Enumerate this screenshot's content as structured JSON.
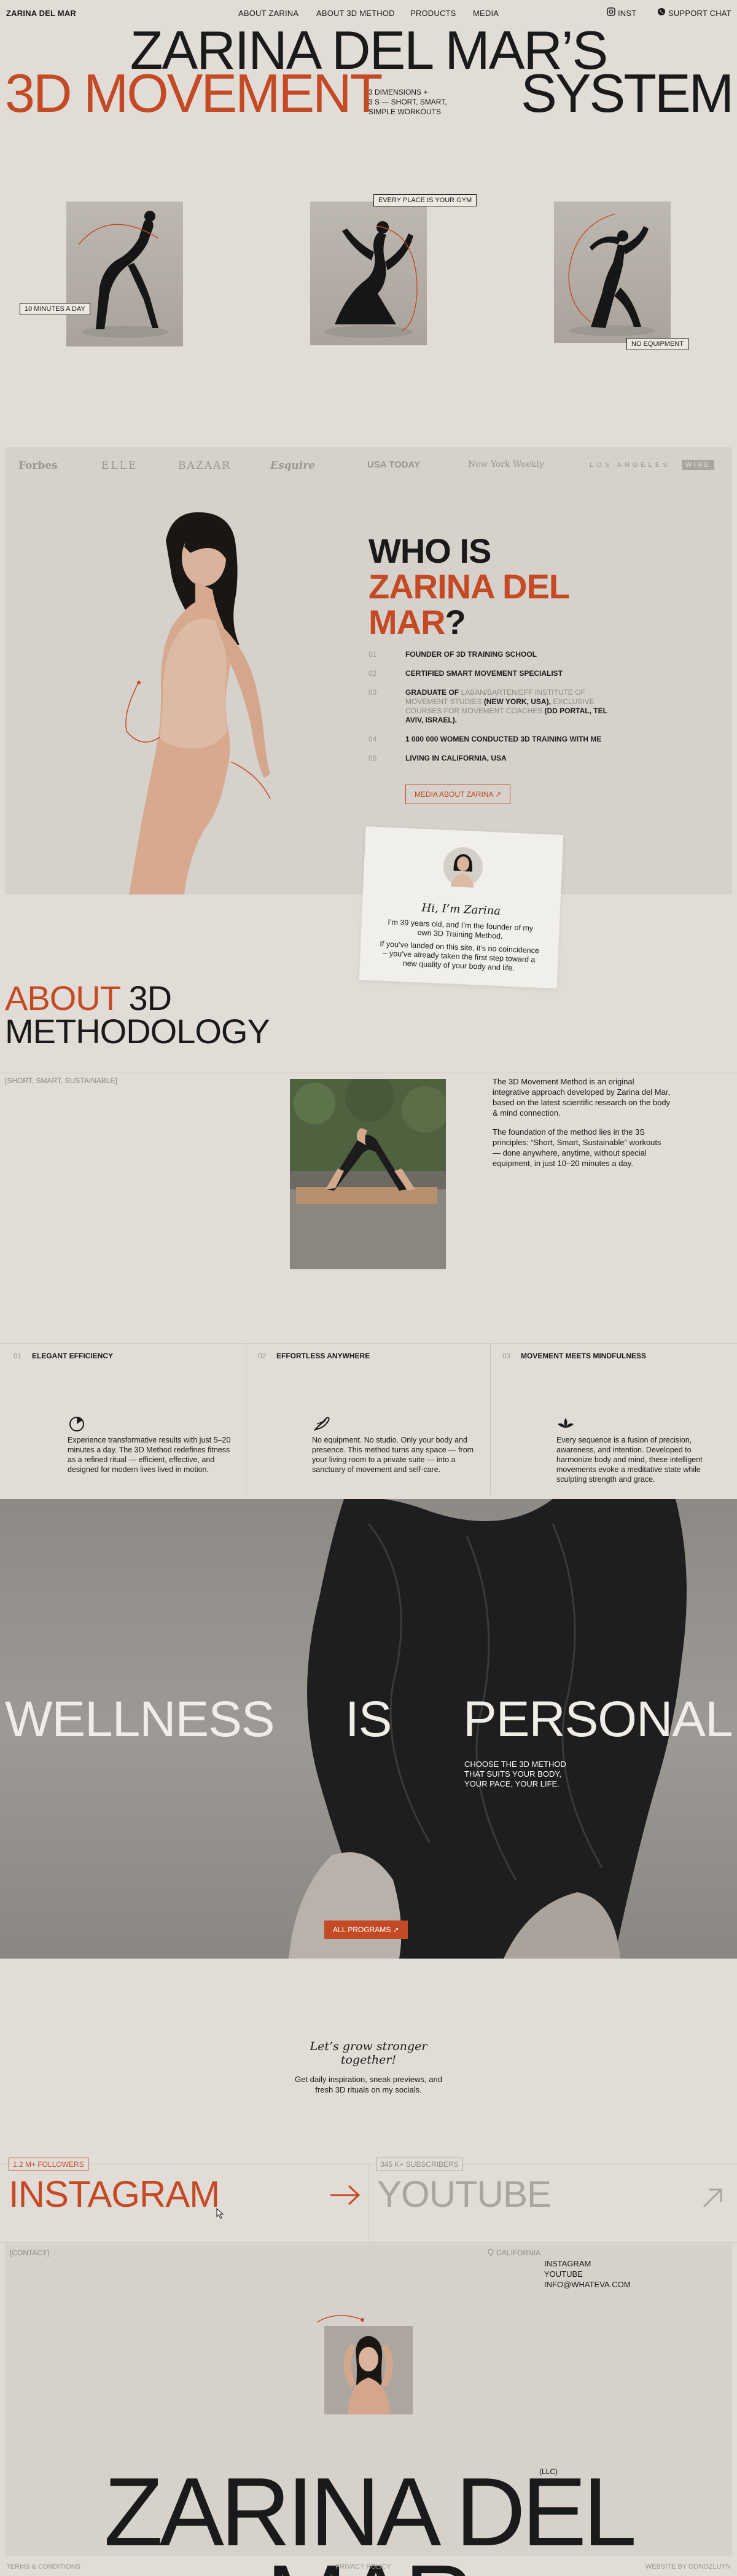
{
  "nav": {
    "brand": "ZARINA DEL MAR",
    "links": [
      "ABOUT ZARINA",
      "ABOUT 3D METHOD",
      "PRODUCTS",
      "MEDIA"
    ],
    "inst": "INST",
    "support": "SUPPORT CHAT"
  },
  "hero": {
    "line1": "ZARINA DEL MAR’S",
    "line2_left": "3D MOVEMENT",
    "line2_right": "SYSTEM",
    "tagline": [
      "3 DIMENSIONS  +",
      "3 S — SHORT, SMART,",
      "SIMPLE WORKOUTS"
    ],
    "tags": {
      "minutes": "10 MINUTES A DAY",
      "gym": "EVERY PLACE IS YOUR GYM",
      "equipment": "NO EQUIPMENT"
    }
  },
  "logos": [
    "Forbes",
    "ELLE",
    "BAZAAR",
    "Esquire",
    "USA TODAY",
    "New York Weekly",
    "LOS ANGELES",
    "WIRE"
  ],
  "who": {
    "title_1": "WHO IS",
    "title_2": "ZARINA DEL",
    "title_3a": "MAR",
    "title_3b": "?",
    "items": [
      {
        "num": "01",
        "text": "FOUNDER OF 3D TRAINING SCHOOL"
      },
      {
        "num": "02",
        "text": "CERTIFIED SMART MOVEMENT SPECIALIST"
      },
      {
        "num": "03",
        "strong": "GRADUATE OF",
        "text": "LABAN/BARTENIEFF INSTITUTE OF MOVEMENT STUDIES",
        "strong2": "(NEW YORK, USA),",
        "text2": "EXCLUSIVE COURSES FOR MOVEMENT COACHES",
        "strong3": "(DD PORTAL, TEL AVIV, ISRAEL)."
      },
      {
        "num": "04",
        "text": "1 000 000 WOMEN CONDUCTED 3D TRAINING WITH ME"
      },
      {
        "num": "05",
        "text": "LIVING IN CALIFORNIA, USA"
      }
    ],
    "media_button": "MEDIA ABOUT ZARINA ↗",
    "note": {
      "greeting": "Hi, I’m Zarina",
      "p1": "I’m 39 years old, and I’m the founder of my own 3D Training Method.",
      "p2": "If you’ve landed on this site, it’s no coincidence – you’ve already taken the first step toward a new quality of your body and life."
    }
  },
  "about": {
    "title_1a": "ABOUT",
    "title_1b": "3D",
    "title_2": "METHODOLOGY",
    "tag": "[SHORT, SMART, SUSTAINABLE]",
    "p1": "The 3D Movement Method is an original integrative approach developed by Zarina del Mar, based on the latest scientific research on the body & mind connection.",
    "p2": "The foundation of the method lies in the 3S principles: “Short, Smart, Sustainable” workouts — done anywhere, anytime, without special equipment, in just 10–20 minutes a day.",
    "features": [
      {
        "num": "01",
        "title": "ELEGANT EFFICIENCY",
        "icon": "timer-icon",
        "text": "Experience transformative results with just 5–20 minutes a day. The 3D Method redefines fitness as a refined ritual — efficient, effective, and designed for modern lives lived in motion."
      },
      {
        "num": "02",
        "title": "EFFORTLESS ANYWHERE",
        "icon": "feather-icon",
        "text": "No equipment. No studio. Only your body and presence. This method turns any space — from your living room to a private suite — into a sanctuary of movement and self-care."
      },
      {
        "num": "03",
        "title": "MOVEMENT MEETS MINDFULNESS",
        "icon": "lotus-icon",
        "text": "Every sequence is a fusion of precision, awareness, and intention. Developed to harmonize body and mind, these intelligent movements evoke a meditative state while sculpting strength and grace."
      }
    ]
  },
  "wellness": {
    "w1": "WELLNESS",
    "w2": "IS",
    "w3": "PERSONAL",
    "sub": [
      "CHOOSE THE 3D METHOD",
      "THAT SUITS YOUR BODY,",
      "YOUR PACE, YOUR LIFE."
    ],
    "button": "ALL PROGRAMS ↗"
  },
  "social": {
    "script": "Let’s grow stronger together!",
    "text": "Get daily inspiration, sneak previews, and fresh 3D rituals on my socials.",
    "instagram_badge": "1.2 M+ FOLLOWERS",
    "instagram": "INSTAGRAM",
    "youtube_badge": "345 K+ SUBSCRIBERS",
    "youtube": "YOUTUBE"
  },
  "contact": {
    "tag": "[CONTACT]",
    "location": "CALIFORNIA",
    "links": [
      "INSTAGRAM",
      "YOUTUBE",
      "INFO@WHATEVA.COM"
    ],
    "llc": "(LLC)",
    "big_name": "ZARINA DEL MAR"
  },
  "footer": {
    "terms": "TERMS & CONDITIONS",
    "privacy": "PRIVACY POLICY",
    "credit": "WEBSITE BY ODNOZLUYN"
  },
  "colors": {
    "accent": "#c44a26",
    "background": "#e1ddd6",
    "panel": "#d6d1ca",
    "text": "#1a1a1a"
  }
}
